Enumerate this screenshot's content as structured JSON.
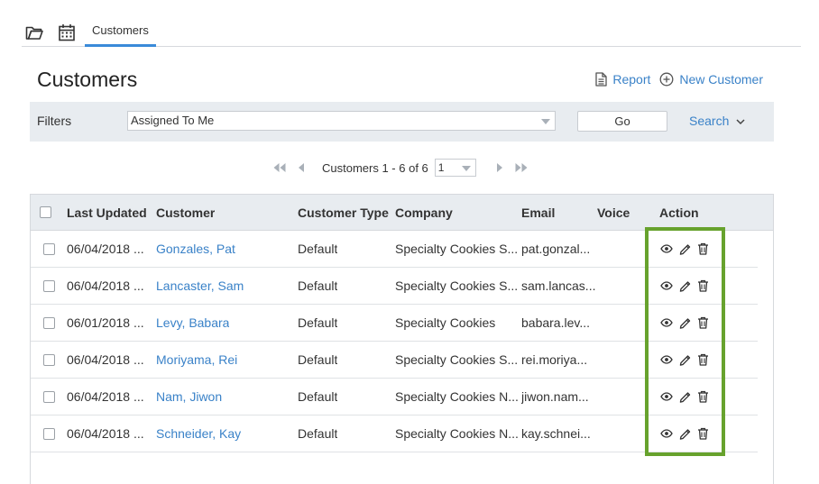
{
  "topbar": {
    "icons": [
      "folder-icon",
      "calendar-icon"
    ],
    "tab_label": "Customers"
  },
  "page": {
    "title": "Customers",
    "report_label": "Report",
    "new_customer_label": "New Customer"
  },
  "filters": {
    "label": "Filters",
    "selected": "Assigned To Me",
    "go_label": "Go",
    "search_label": "Search"
  },
  "pager": {
    "summary": "Customers 1 - 6 of 6",
    "page_value": "1"
  },
  "table": {
    "headers": {
      "last_updated": "Last Updated",
      "customer": "Customer",
      "customer_type": "Customer Type",
      "company": "Company",
      "email": "Email",
      "voice": "Voice",
      "action": "Action"
    },
    "rows": [
      {
        "last_updated": "06/04/2018 ...",
        "customer": "Gonzales, Pat",
        "customer_type": "Default",
        "company": "Specialty Cookies S...",
        "email": "pat.gonzal...",
        "voice": ""
      },
      {
        "last_updated": "06/04/2018 ...",
        "customer": "Lancaster, Sam",
        "customer_type": "Default",
        "company": "Specialty Cookies S...",
        "email": "sam.lancas...",
        "voice": ""
      },
      {
        "last_updated": "06/01/2018 ...",
        "customer": "Levy, Babara",
        "customer_type": "Default",
        "company": "Specialty Cookies",
        "email": "babara.lev...",
        "voice": ""
      },
      {
        "last_updated": "06/04/2018 ...",
        "customer": "Moriyama, Rei",
        "customer_type": "Default",
        "company": "Specialty Cookies S...",
        "email": "rei.moriya...",
        "voice": ""
      },
      {
        "last_updated": "06/04/2018 ...",
        "customer": "Nam, Jiwon",
        "customer_type": "Default",
        "company": "Specialty Cookies N...",
        "email": "jiwon.nam...",
        "voice": ""
      },
      {
        "last_updated": "06/04/2018 ...",
        "customer": "Schneider, Kay",
        "customer_type": "Default",
        "company": "Specialty Cookies N...",
        "email": "kay.schnei...",
        "voice": ""
      }
    ],
    "row_action_icons": [
      "eye-icon",
      "pencil-icon",
      "trash-icon"
    ]
  },
  "colors": {
    "accent": "#3a82c8",
    "tab_underline": "#3a8ad9",
    "highlight_border": "#67a22d",
    "header_bg": "#e8ecf0"
  }
}
